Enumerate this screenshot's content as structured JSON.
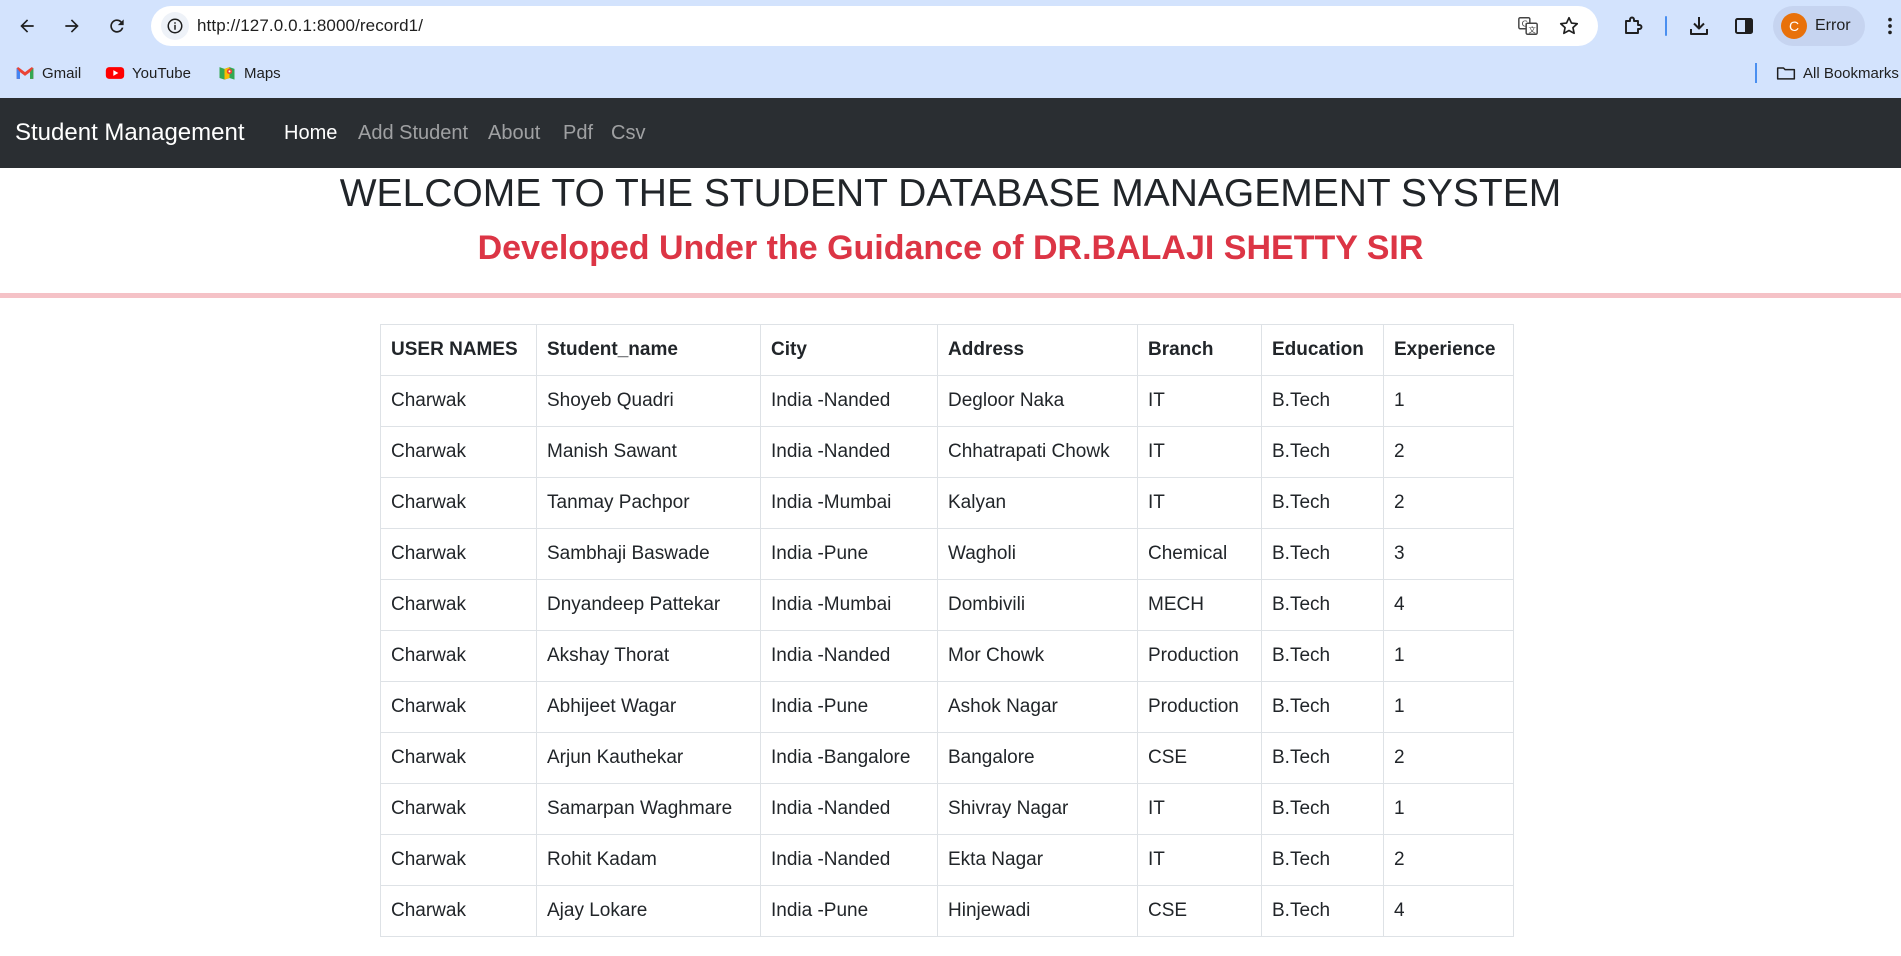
{
  "browser": {
    "url": "http://127.0.0.1:8000/record1/",
    "profile_initial": "C",
    "profile_label": "Error",
    "bookmarks": [
      {
        "label": "Gmail",
        "icon": "gmail-icon"
      },
      {
        "label": "YouTube",
        "icon": "youtube-icon"
      },
      {
        "label": "Maps",
        "icon": "maps-icon"
      }
    ],
    "all_bookmarks": "All Bookmarks"
  },
  "navbar": {
    "brand": "Student Management",
    "links": [
      "Home",
      "Add Student",
      "About",
      "Pdf",
      "Csv"
    ],
    "active": "Home"
  },
  "page": {
    "title": "WELCOME TO THE STUDENT DATABASE MANAGEMENT SYSTEM",
    "subtitle": "Developed Under the Guidance of DR.BALAJI SHETTY SIR"
  },
  "colors": {
    "chrome_bg": "#d3e3fd",
    "navbar_bg": "#2a2e32",
    "subtitle": "#dc3545",
    "divider": "#f5c2c7"
  },
  "table": {
    "headers": [
      "USER NAMES",
      "Student_name",
      "City",
      "Address",
      "Branch",
      "Education",
      "Experience"
    ],
    "rows": [
      [
        "Charwak",
        "Shoyeb Quadri",
        "India -Nanded",
        "Degloor Naka",
        "IT",
        "B.Tech",
        "1"
      ],
      [
        "Charwak",
        "Manish Sawant",
        "India -Nanded",
        "Chhatrapati Chowk",
        "IT",
        "B.Tech",
        "2"
      ],
      [
        "Charwak",
        "Tanmay Pachpor",
        "India -Mumbai",
        "Kalyan",
        "IT",
        "B.Tech",
        "2"
      ],
      [
        "Charwak",
        "Sambhaji Baswade",
        "India -Pune",
        "Wagholi",
        "Chemical",
        "B.Tech",
        "3"
      ],
      [
        "Charwak",
        "Dnyandeep Pattekar",
        "India -Mumbai",
        "Dombivili",
        "MECH",
        "B.Tech",
        "4"
      ],
      [
        "Charwak",
        "Akshay Thorat",
        "India -Nanded",
        "Mor Chowk",
        "Production",
        "B.Tech",
        "1"
      ],
      [
        "Charwak",
        "Abhijeet Wagar",
        "India -Pune",
        "Ashok Nagar",
        "Production",
        "B.Tech",
        "1"
      ],
      [
        "Charwak",
        "Arjun Kauthekar",
        "India -Bangalore",
        "Bangalore",
        "CSE",
        "B.Tech",
        "2"
      ],
      [
        "Charwak",
        "Samarpan Waghmare",
        "India -Nanded",
        "Shivray Nagar",
        "IT",
        "B.Tech",
        "1"
      ],
      [
        "Charwak",
        "Rohit Kadam",
        "India -Nanded",
        "Ekta Nagar",
        "IT",
        "B.Tech",
        "2"
      ],
      [
        "Charwak",
        "Ajay Lokare",
        "India -Pune",
        "Hinjewadi",
        "CSE",
        "B.Tech",
        "4"
      ]
    ]
  }
}
